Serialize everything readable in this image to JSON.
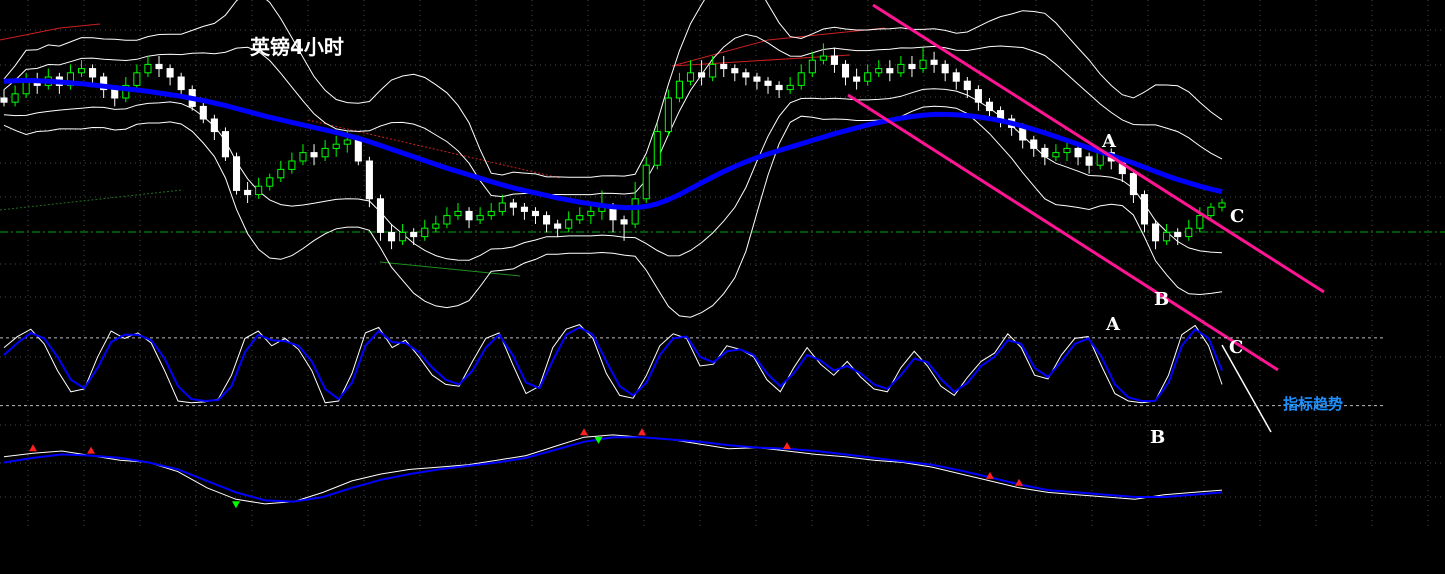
{
  "chart_data": {
    "type": "candlestick",
    "title": "英镑4小时",
    "colors": {
      "background": "#000000",
      "bull_candle": "#00ff00",
      "bear_candle": "#ffffff",
      "moving_average": "#0000ff",
      "bollinger_band": "#ffffff",
      "channel": "#ff1493",
      "reference_line": "#00aa00",
      "note_text": "#1e90ff",
      "marker_up": "#ff2020",
      "marker_down": "#00ff00"
    },
    "grid": true,
    "candles": [
      [
        10,
        9,
        12,
        8
      ],
      [
        9,
        11,
        13,
        8
      ],
      [
        11,
        14,
        16,
        10
      ],
      [
        14,
        13,
        16,
        11
      ],
      [
        13,
        15,
        17,
        12
      ],
      [
        15,
        13,
        16,
        11
      ],
      [
        13,
        16,
        18,
        12
      ],
      [
        16,
        17,
        19,
        15
      ],
      [
        17,
        15,
        18,
        13
      ],
      [
        15,
        12,
        16,
        10
      ],
      [
        12,
        10,
        13,
        8
      ],
      [
        10,
        13,
        15,
        9
      ],
      [
        13,
        16,
        18,
        12
      ],
      [
        16,
        18,
        20,
        15
      ],
      [
        18,
        17,
        20,
        15
      ],
      [
        17,
        15,
        18,
        13
      ],
      [
        15,
        12,
        16,
        10
      ],
      [
        12,
        8,
        13,
        7
      ],
      [
        8,
        5,
        9,
        4
      ],
      [
        5,
        2,
        6,
        0
      ],
      [
        2,
        -4,
        3,
        -5
      ],
      [
        -4,
        -12,
        -3,
        -13
      ],
      [
        -12,
        -13,
        -10,
        -15
      ],
      [
        -13,
        -11,
        -9,
        -14
      ],
      [
        -11,
        -9,
        -8,
        -12
      ],
      [
        -9,
        -7,
        -5,
        -10
      ],
      [
        -7,
        -5,
        -3,
        -8
      ],
      [
        -5,
        -3,
        -1,
        -6
      ],
      [
        -3,
        -4,
        -1,
        -6
      ],
      [
        -4,
        -2,
        0,
        -5
      ],
      [
        -2,
        -1,
        1,
        -4
      ],
      [
        -1,
        0,
        2,
        -3
      ],
      [
        0,
        -5,
        1,
        -6
      ],
      [
        -5,
        -14,
        -4,
        -16
      ],
      [
        -14,
        -22,
        -13,
        -24
      ],
      [
        -22,
        -24,
        -20,
        -26
      ],
      [
        -24,
        -22,
        -20,
        -25
      ],
      [
        -22,
        -23,
        -21,
        -25
      ],
      [
        -23,
        -21,
        -19,
        -24
      ],
      [
        -21,
        -20,
        -18,
        -22
      ],
      [
        -20,
        -18,
        -16,
        -21
      ],
      [
        -18,
        -17,
        -15,
        -19
      ],
      [
        -17,
        -19,
        -16,
        -21
      ],
      [
        -19,
        -18,
        -16,
        -20
      ],
      [
        -18,
        -17,
        -15,
        -19
      ],
      [
        -17,
        -15,
        -13,
        -18
      ],
      [
        -15,
        -16,
        -14,
        -18
      ],
      [
        -16,
        -17,
        -15,
        -19
      ],
      [
        -17,
        -18,
        -16,
        -20
      ],
      [
        -18,
        -20,
        -17,
        -22
      ],
      [
        -20,
        -21,
        -19,
        -23
      ],
      [
        -21,
        -19,
        -17,
        -22
      ],
      [
        -19,
        -18,
        -16,
        -20
      ],
      [
        -18,
        -17,
        -15,
        -20
      ],
      [
        -17,
        -16,
        -12,
        -19
      ],
      [
        -16,
        -19,
        -15,
        -22
      ],
      [
        -19,
        -20,
        -18,
        -24
      ],
      [
        -20,
        -14,
        -10,
        -21
      ],
      [
        -14,
        -6,
        -4,
        -15
      ],
      [
        -6,
        2,
        4,
        -7
      ],
      [
        2,
        10,
        12,
        1
      ],
      [
        10,
        14,
        16,
        9
      ],
      [
        14,
        16,
        19,
        13
      ],
      [
        16,
        15,
        19,
        13
      ],
      [
        15,
        18,
        20,
        14
      ],
      [
        18,
        17,
        20,
        15
      ],
      [
        17,
        16,
        18,
        14
      ],
      [
        16,
        15,
        17,
        13
      ],
      [
        15,
        14,
        16,
        12
      ],
      [
        14,
        13,
        15,
        11
      ],
      [
        13,
        12,
        14,
        10
      ],
      [
        12,
        13,
        15,
        11
      ],
      [
        13,
        16,
        18,
        12
      ],
      [
        16,
        19,
        21,
        15
      ],
      [
        19,
        20,
        23,
        18
      ],
      [
        20,
        18,
        22,
        16
      ],
      [
        18,
        15,
        19,
        13
      ],
      [
        15,
        14,
        17,
        12
      ],
      [
        14,
        16,
        18,
        13
      ],
      [
        16,
        17,
        19,
        15
      ],
      [
        17,
        16,
        19,
        14
      ],
      [
        16,
        18,
        20,
        15
      ],
      [
        18,
        17,
        20,
        15
      ],
      [
        17,
        19,
        22,
        16
      ],
      [
        19,
        18,
        21,
        16
      ],
      [
        18,
        16,
        19,
        14
      ],
      [
        16,
        14,
        17,
        12
      ],
      [
        14,
        12,
        15,
        10
      ],
      [
        12,
        9,
        13,
        7
      ],
      [
        9,
        7,
        10,
        5
      ],
      [
        7,
        5,
        8,
        3
      ],
      [
        5,
        3,
        6,
        1
      ],
      [
        3,
        0,
        4,
        -2
      ],
      [
        0,
        -2,
        1,
        -4
      ],
      [
        -2,
        -4,
        -1,
        -6
      ],
      [
        -4,
        -3,
        -1,
        -5
      ],
      [
        -3,
        -2,
        0,
        -5
      ],
      [
        -2,
        -4,
        -1,
        -6
      ],
      [
        -4,
        -6,
        -3,
        -8
      ],
      [
        -6,
        -3,
        -2,
        -7
      ],
      [
        -3,
        -5,
        -2,
        -7
      ],
      [
        -5,
        -8,
        -4,
        -10
      ],
      [
        -8,
        -13,
        -7,
        -15
      ],
      [
        -13,
        -20,
        -12,
        -22
      ],
      [
        -20,
        -24,
        -19,
        -26
      ],
      [
        -24,
        -22,
        -20,
        -25
      ],
      [
        -22,
        -23,
        -21,
        -25
      ],
      [
        -23,
        -21,
        -19,
        -24
      ],
      [
        -21,
        -18,
        -16,
        -22
      ],
      [
        -18,
        -16,
        -15,
        -19
      ],
      [
        -16,
        -15,
        -14,
        -17
      ]
    ],
    "moving_average": [
      14,
      14.1,
      14.2,
      14.1,
      14,
      13.8,
      13.6,
      13.4,
      13.1,
      12.8,
      12.5,
      12.2,
      11.9,
      11.6,
      11.2,
      10.8,
      10.4,
      9.9,
      9.4,
      8.8,
      8.2,
      7.5,
      6.8,
      6.1,
      5.4,
      4.8,
      4.2,
      3.6,
      3,
      2.4,
      1.8,
      1.1,
      0.4,
      -0.4,
      -1.3,
      -2.2,
      -3.1,
      -4,
      -4.9,
      -5.8,
      -6.7,
      -7.5,
      -8.3,
      -9.1,
      -9.9,
      -10.7,
      -11.4,
      -12,
      -12.6,
      -13.2,
      -13.8,
      -14.3,
      -14.8,
      -15.2,
      -15.6,
      -15.9,
      -16.1,
      -16.1,
      -15.8,
      -15.2,
      -14.2,
      -13,
      -11.6,
      -10.2,
      -8.8,
      -7.5,
      -6.3,
      -5.2,
      -4.2,
      -3.3,
      -2.5,
      -1.7,
      -0.9,
      -0.1,
      0.7,
      1.5,
      2.2,
      2.9,
      3.6,
      4.2,
      4.7,
      5.2,
      5.6,
      5.9,
      6.1,
      6.1,
      6,
      5.8,
      5.5,
      5.1,
      4.6,
      4,
      3.3,
      2.5,
      1.7,
      0.8,
      -0.1,
      -1,
      -1.9,
      -2.8,
      -3.7,
      -4.6,
      -5.5,
      -6.5,
      -7.5,
      -8.5,
      -9.4,
      -10.2,
      -11,
      -11.7,
      -12.3
    ],
    "annotations": {
      "price": [
        {
          "text": "A"
        },
        {
          "text": "B"
        },
        {
          "text": "C"
        }
      ],
      "stochastic": [
        {
          "text": "A"
        },
        {
          "text": "B"
        },
        {
          "text": "C"
        }
      ],
      "indicator_trend_note": "指标趋势"
    },
    "stochastic": {
      "k": [
        70,
        82,
        90,
        74,
        45,
        22,
        25,
        60,
        88,
        80,
        86,
        75,
        45,
        12,
        10,
        11,
        14,
        40,
        80,
        88,
        72,
        80,
        68,
        45,
        10,
        12,
        42,
        86,
        92,
        70,
        78,
        60,
        40,
        30,
        28,
        55,
        80,
        86,
        52,
        20,
        28,
        70,
        90,
        95,
        80,
        42,
        18,
        15,
        40,
        72,
        85,
        80,
        50,
        52,
        72,
        68,
        60,
        35,
        22,
        48,
        70,
        52,
        40,
        55,
        38,
        25,
        22,
        48,
        66,
        50,
        28,
        18,
        38,
        55,
        64,
        85,
        70,
        40,
        36,
        62,
        80,
        82,
        50,
        20,
        12,
        10,
        12,
        40,
        84,
        94,
        72,
        30
      ],
      "d": [
        62,
        75,
        86,
        80,
        60,
        35,
        26,
        48,
        76,
        84,
        84,
        78,
        58,
        28,
        14,
        12,
        13,
        28,
        65,
        84,
        78,
        77,
        72,
        55,
        25,
        14,
        32,
        72,
        88,
        76,
        75,
        65,
        48,
        35,
        30,
        45,
        70,
        84,
        62,
        32,
        26,
        56,
        84,
        92,
        84,
        55,
        28,
        18,
        32,
        62,
        80,
        82,
        60,
        54,
        66,
        68,
        62,
        42,
        28,
        42,
        62,
        56,
        45,
        50,
        42,
        30,
        25,
        40,
        58,
        54,
        36,
        22,
        32,
        50,
        60,
        78,
        74,
        48,
        38,
        55,
        74,
        80,
        60,
        30,
        16,
        12,
        12,
        32,
        72,
        90,
        80,
        45
      ],
      "upper_level": 80,
      "lower_level": 20
    },
    "oscillator": {
      "fast": [
        55,
        58,
        60,
        56,
        52,
        50,
        42,
        28,
        18,
        14,
        16,
        24,
        34,
        40,
        44,
        46,
        48,
        52,
        56,
        64,
        72,
        74,
        72,
        70,
        66,
        62,
        63,
        60,
        57,
        55,
        52,
        50,
        46,
        40,
        34,
        28,
        24,
        22,
        20,
        18,
        22,
        24,
        26
      ],
      "slow": [
        50,
        54,
        57,
        56,
        54,
        50,
        44,
        34,
        24,
        17,
        16,
        20,
        28,
        35,
        40,
        44,
        47,
        50,
        54,
        61,
        68,
        72,
        72,
        70,
        68,
        65,
        63,
        62,
        60,
        57,
        54,
        51,
        48,
        43,
        37,
        31,
        26,
        24,
        22,
        20,
        20,
        22,
        24
      ]
    }
  }
}
